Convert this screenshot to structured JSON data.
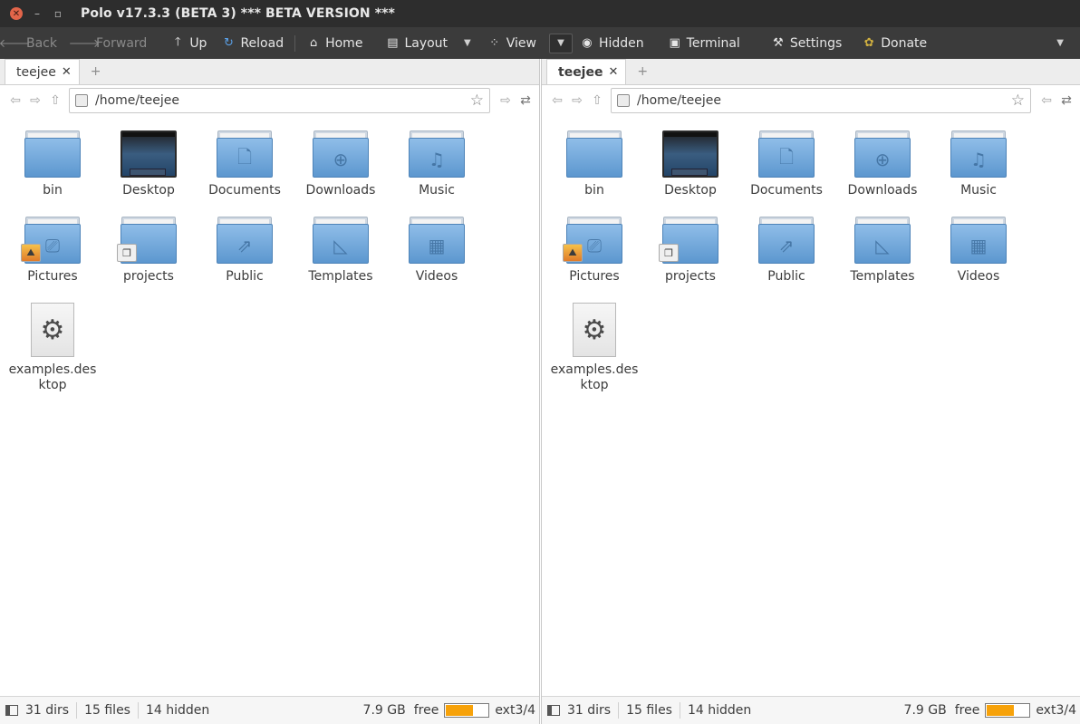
{
  "window": {
    "title": "Polo v17.3.3 (BETA 3)  *** BETA VERSION ***"
  },
  "toolbar": {
    "back": "Back",
    "forward": "Forward",
    "up": "Up",
    "reload": "Reload",
    "home": "Home",
    "layout": "Layout",
    "view": "View",
    "hidden": "Hidden",
    "terminal": "Terminal",
    "settings": "Settings",
    "donate": "Donate"
  },
  "panes": [
    {
      "tab": "teejee",
      "path": "/home/teejee",
      "items": [
        {
          "name": "bin",
          "icon": "folder"
        },
        {
          "name": "Desktop",
          "icon": "desktop"
        },
        {
          "name": "Documents",
          "icon": "document"
        },
        {
          "name": "Downloads",
          "icon": "download"
        },
        {
          "name": "Music",
          "icon": "music"
        },
        {
          "name": "Pictures",
          "icon": "pictures"
        },
        {
          "name": "projects",
          "icon": "projects"
        },
        {
          "name": "Public",
          "icon": "share"
        },
        {
          "name": "Templates",
          "icon": "template"
        },
        {
          "name": "Videos",
          "icon": "video"
        },
        {
          "name": "examples.des\nktop",
          "icon": "gear"
        }
      ],
      "status": {
        "dirs": "31 dirs",
        "files": "15 files",
        "hidden": "14 hidden",
        "free_size": "7.9 GB",
        "free_label": "free",
        "fs": "ext3/4",
        "usage_fraction": 0.65
      }
    },
    {
      "tab": "teejee",
      "path": "/home/teejee",
      "items": [
        {
          "name": "bin",
          "icon": "folder"
        },
        {
          "name": "Desktop",
          "icon": "desktop"
        },
        {
          "name": "Documents",
          "icon": "document"
        },
        {
          "name": "Downloads",
          "icon": "download"
        },
        {
          "name": "Music",
          "icon": "music"
        },
        {
          "name": "Pictures",
          "icon": "pictures"
        },
        {
          "name": "projects",
          "icon": "projects"
        },
        {
          "name": "Public",
          "icon": "share"
        },
        {
          "name": "Templates",
          "icon": "template"
        },
        {
          "name": "Videos",
          "icon": "video"
        },
        {
          "name": "examples.des\nktop",
          "icon": "gear"
        }
      ],
      "status": {
        "dirs": "31 dirs",
        "files": "15 files",
        "hidden": "14 hidden",
        "free_size": "7.9 GB",
        "free_label": "free",
        "fs": "ext3/4",
        "usage_fraction": 0.65
      }
    }
  ]
}
